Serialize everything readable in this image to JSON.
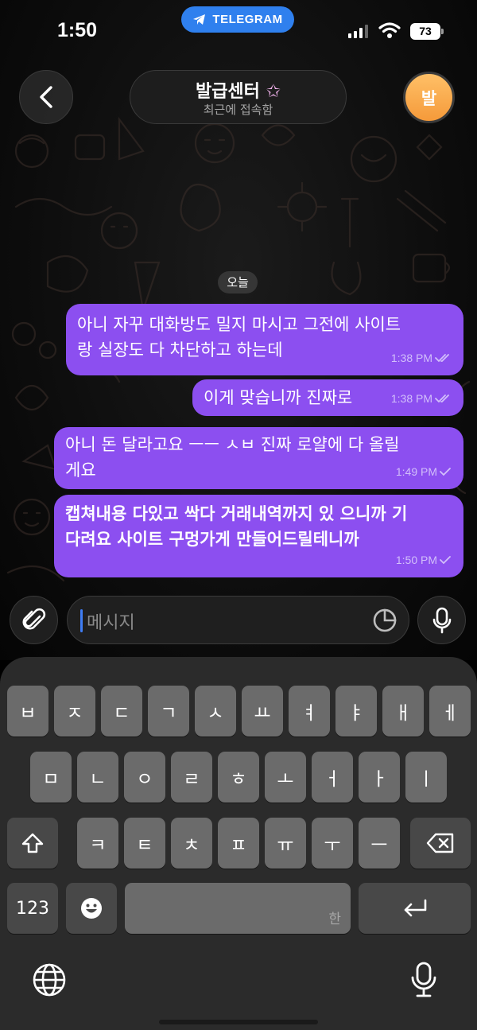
{
  "status_bar": {
    "time": "1:50",
    "app_pill": "TELEGRAM",
    "battery": "73"
  },
  "header": {
    "title": "발급센터",
    "title_emoji": "✩",
    "status": "최근에 접속함",
    "avatar_initial": "발"
  },
  "date_divider": "오늘",
  "messages": [
    {
      "lines": [
        "아니 자꾸 대화방도 밀지 마시고 그전에 사이트",
        "랑 실장도 다 차단하고 하는데"
      ],
      "time": "1:38 PM",
      "read": "double-check"
    },
    {
      "lines": [
        "이게 맞습니까 진짜로"
      ],
      "time": "1:38 PM",
      "read": "double-check"
    },
    {
      "lines": [
        "아니 돈 달라고요 ㅡㅡ ㅅㅂ 진짜 로얄에 다 올릴",
        "게요"
      ],
      "time": "1:49 PM",
      "read": "single-check"
    },
    {
      "lines": [
        "캡쳐내용 다있고 싹다 거래내역까지 있 으니까 기",
        "다려요 사이트 구멍가게 만들어드릴테니까"
      ],
      "time": "1:50 PM",
      "read": "single-check"
    }
  ],
  "composer": {
    "placeholder": "메시지"
  },
  "keyboard": {
    "row1": [
      "ㅂ",
      "ㅈ",
      "ㄷ",
      "ㄱ",
      "ㅅ",
      "ㅛ",
      "ㅕ",
      "ㅑ",
      "ㅐ",
      "ㅔ"
    ],
    "row2": [
      "ㅁ",
      "ㄴ",
      "ㅇ",
      "ㄹ",
      "ㅎ",
      "ㅗ",
      "ㅓ",
      "ㅏ",
      "ㅣ"
    ],
    "row3": [
      "ㅋ",
      "ㅌ",
      "ㅊ",
      "ㅍ",
      "ㅠ",
      "ㅜ",
      "ㅡ"
    ],
    "numbers_key": "123",
    "space_hint": "한"
  },
  "colors": {
    "bubble": "#8c4ff0",
    "telegram_blue": "#2f80ee",
    "avatar": "#f5a84a",
    "caret": "#3f7df5"
  }
}
